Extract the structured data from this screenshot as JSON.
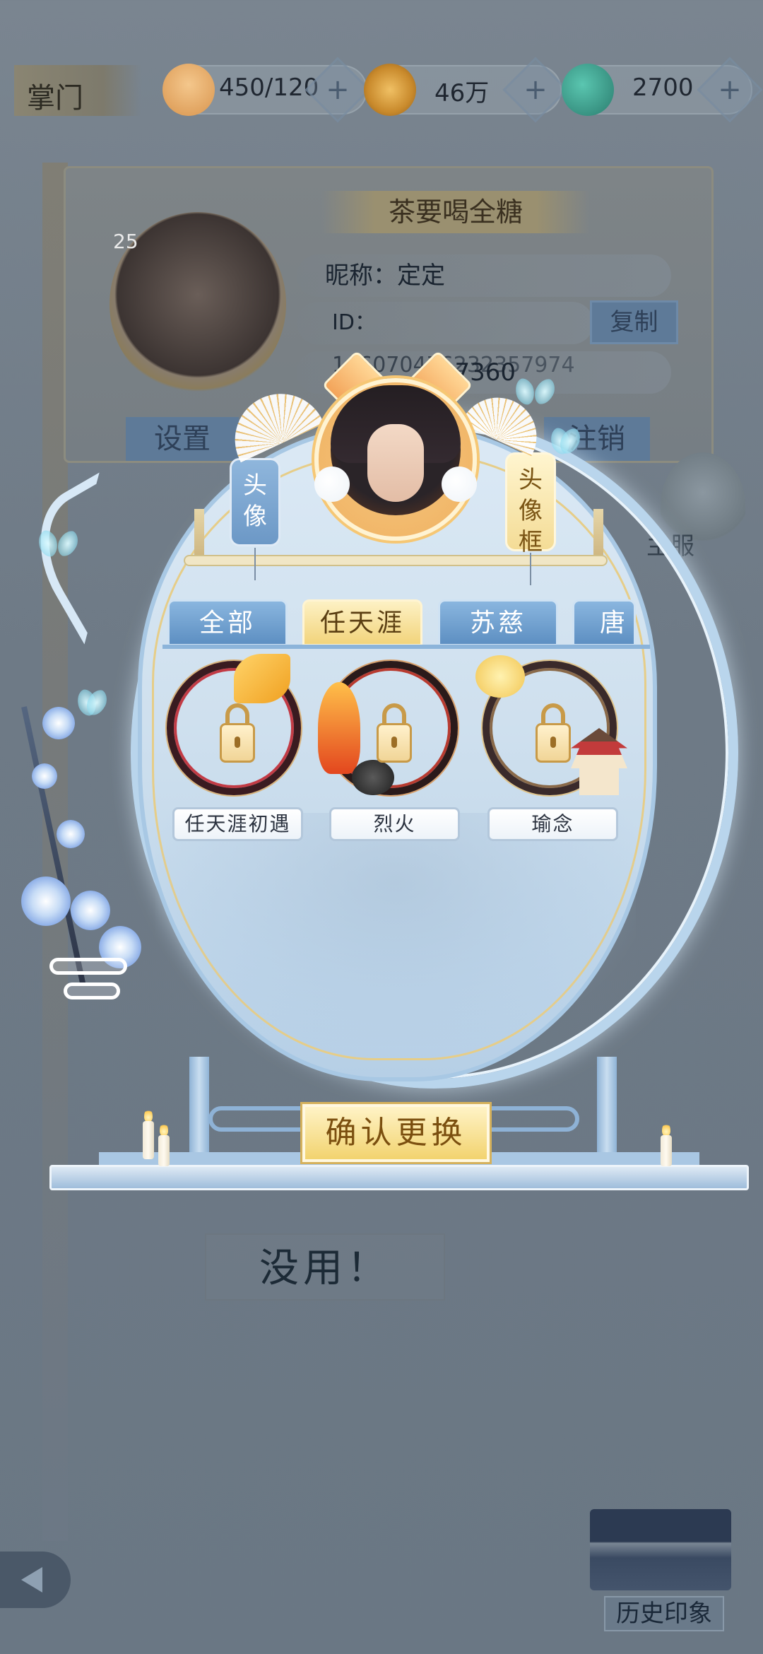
{
  "topbar": {
    "role": "掌门",
    "resources": [
      {
        "icon": "cat-food-icon",
        "value": "450/120"
      },
      {
        "icon": "copper-coin-icon",
        "value": "46万"
      },
      {
        "icon": "jade-icon",
        "value": "2700"
      }
    ],
    "plus": "+"
  },
  "profile": {
    "title": "茶要喝全糖",
    "level": "25",
    "nickname": "昵称：定定",
    "id": "ID：146070476232357974",
    "copy_label": "复制",
    "score": "7360",
    "settings_label": "设置",
    "logout_label": "注销"
  },
  "modal": {
    "tag_avatar": "头像",
    "tag_frame": "头像框",
    "tabs": [
      {
        "label": "全部",
        "active": false
      },
      {
        "label": "任天涯",
        "active": true
      },
      {
        "label": "苏慈",
        "active": false
      },
      {
        "label": "唐",
        "active": false
      }
    ],
    "frames": [
      {
        "name": "任天涯初遇",
        "locked": true
      },
      {
        "name": "烈火",
        "locked": true
      },
      {
        "name": "瑜念",
        "locked": true
      }
    ],
    "confirm_label": "确认更换"
  },
  "background": {
    "mascot_label": "主服",
    "useless_label": "没用！",
    "history_label": "历史印象"
  },
  "colors": {
    "accent_gold": "#f2d36f",
    "panel_blue": "#cfe0ee",
    "tab_blue": "#5d8fc2"
  }
}
